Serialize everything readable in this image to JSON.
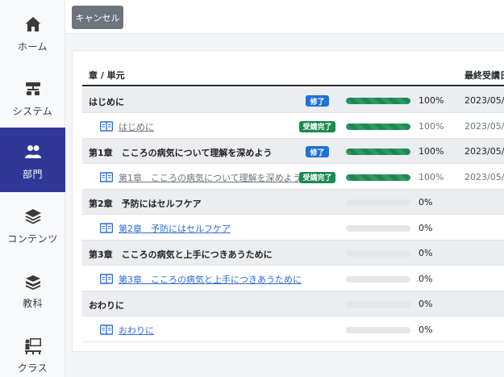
{
  "sidebar": {
    "items": [
      {
        "label": "ホーム",
        "icon": "home-icon"
      },
      {
        "label": "システム",
        "icon": "sitemap-icon"
      },
      {
        "label": "部門",
        "icon": "users-icon"
      },
      {
        "label": "コンテンツ",
        "icon": "layers-icon"
      },
      {
        "label": "教科",
        "icon": "books-icon"
      },
      {
        "label": "クラス",
        "icon": "classroom-icon"
      }
    ],
    "active_index": 2
  },
  "toolbar": {
    "cancel_label": "キャンセル"
  },
  "table": {
    "col_title": "章 / 単元",
    "col_date": "最終受講日",
    "rows": [
      {
        "kind": "chapter",
        "title": "はじめに",
        "badge": "修了",
        "progress": 100,
        "percent": "100%",
        "date": "2023/05/0"
      },
      {
        "kind": "unit",
        "title": "はじめに",
        "badge": "受講完了",
        "progress": 100,
        "percent": "100%",
        "date": "2023/05/0"
      },
      {
        "kind": "chapter",
        "title": "第1章　こころの病気について理解を深めよう",
        "badge": "修了",
        "progress": 100,
        "percent": "100%",
        "date": "2023/05/0"
      },
      {
        "kind": "unit",
        "title": "第1章　こころの病気について理解を深めよう",
        "badge": "受講完了",
        "progress": 100,
        "percent": "100%",
        "date": "2023/05/0"
      },
      {
        "kind": "chapter",
        "title": "第2章　予防にはセルフケア",
        "badge": "",
        "progress": 0,
        "percent": "0%",
        "date": ""
      },
      {
        "kind": "unit",
        "title": "第2章　予防にはセルフケア",
        "badge": "",
        "progress": 0,
        "percent": "0%",
        "date": ""
      },
      {
        "kind": "chapter",
        "title": "第3章　こころの病気と上手につきあうために",
        "badge": "",
        "progress": 0,
        "percent": "0%",
        "date": ""
      },
      {
        "kind": "unit",
        "title": "第3章　こころの病気と上手につきあうために",
        "badge": "",
        "progress": 0,
        "percent": "0%",
        "date": ""
      },
      {
        "kind": "chapter",
        "title": "おわりに",
        "badge": "",
        "progress": 0,
        "percent": "0%",
        "date": ""
      },
      {
        "kind": "unit",
        "title": "おわりに",
        "badge": "",
        "progress": 0,
        "percent": "0%",
        "date": ""
      }
    ]
  },
  "colors": {
    "active_nav": "#2f3797",
    "badge_blue": "#1f72d8",
    "badge_green": "#1a8a4f",
    "progress": "#2a9a63",
    "link": "#2f6bd6"
  }
}
